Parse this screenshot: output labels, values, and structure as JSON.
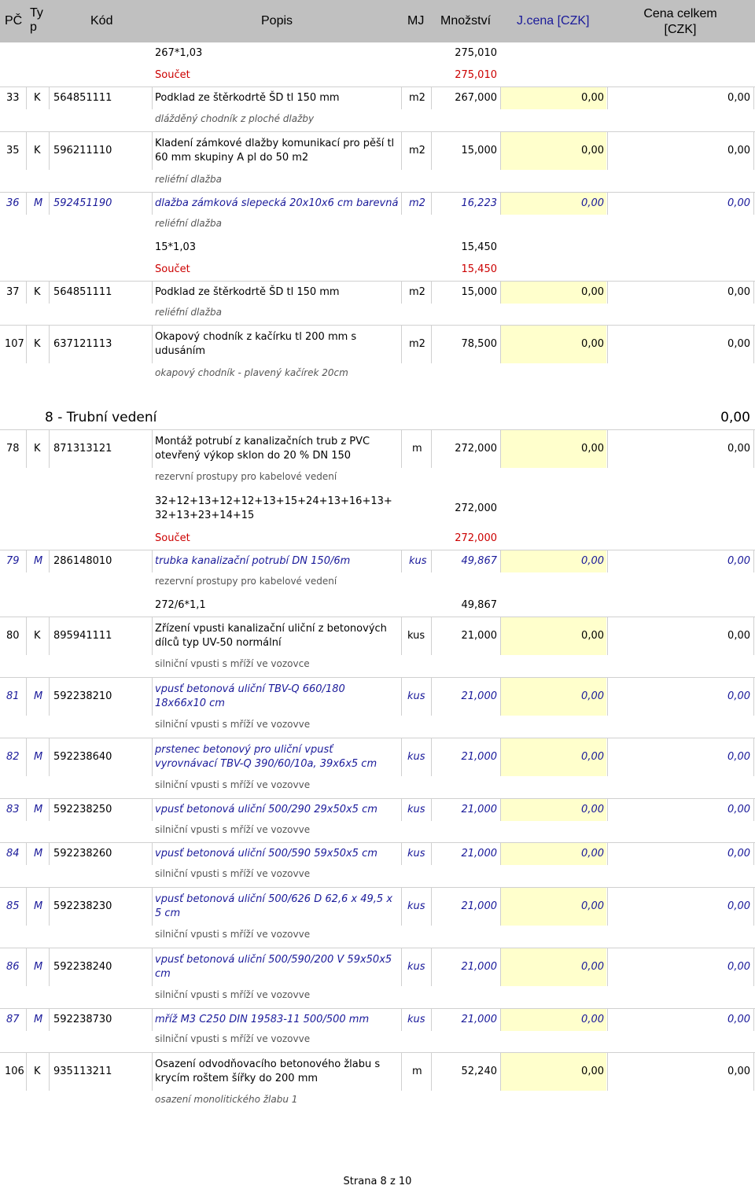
{
  "header": {
    "pc": "PČ",
    "typ": "Ty p",
    "kod": "Kód",
    "popis": "Popis",
    "mj": "MJ",
    "mnozstvi": "Množství",
    "jcena": "J.cena [CZK]",
    "cena_celkem": "Cena celkem [CZK]"
  },
  "calc_top": {
    "formula": "267*1,03",
    "value": "275,010",
    "soucet_label": "Součet",
    "soucet_value": "275,010"
  },
  "items": [
    {
      "pc": "33",
      "typ": "K",
      "kod": "564851111",
      "popis": "Podklad ze štěrkodrtě ŠD tl 150 mm",
      "mj": "m2",
      "mnozstvi": "267,000",
      "jcena": "0,00",
      "celkem": "0,00",
      "note": "dlážděný chodník z ploché dlažby"
    },
    {
      "pc": "35",
      "typ": "K",
      "kod": "596211110",
      "popis": "Kladení zámkové dlažby komunikací pro pěší tl 60 mm skupiny A pl do 50 m2",
      "mj": "m2",
      "mnozstvi": "15,000",
      "jcena": "0,00",
      "celkem": "0,00",
      "note": "reliéfní dlažba"
    },
    {
      "pc": "36",
      "typ": "M",
      "kod": "592451190",
      "popis": "dlažba zámková slepecká 20x10x6 cm barevná",
      "mj": "m2",
      "mnozstvi": "16,223",
      "jcena": "0,00",
      "celkem": "0,00",
      "note": "reliéfní dlažba",
      "calc_formula": "15*1,03",
      "calc_value": "15,450",
      "soucet_label": "Součet",
      "soucet_value": "15,450"
    },
    {
      "pc": "37",
      "typ": "K",
      "kod": "564851111",
      "popis": "Podklad ze štěrkodrtě ŠD tl 150 mm",
      "mj": "m2",
      "mnozstvi": "15,000",
      "jcena": "0,00",
      "celkem": "0,00",
      "note": "reliéfní dlažba"
    },
    {
      "pc": "107",
      "typ": "K",
      "kod": "637121113",
      "popis": "Okapový chodník z kačírku tl 200 mm s udusáním",
      "mj": "m2",
      "mnozstvi": "78,500",
      "jcena": "0,00",
      "celkem": "0,00",
      "note": "okapový chodník - plavený kačírek 20cm"
    }
  ],
  "section": {
    "title": "8 - Trubní vedení",
    "total": "0,00"
  },
  "items2": [
    {
      "pc": "78",
      "typ": "K",
      "kod": "871313121",
      "popis": "Montáž potrubí z kanalizačních trub z PVC otevřený výkop sklon do 20 % DN 150",
      "mj": "m",
      "mnozstvi": "272,000",
      "jcena": "0,00",
      "celkem": "0,00",
      "note": "rezervní prostupy pro kabelové vedení",
      "calc_formula": "32+12+13+12+12+13+15+24+13+16+13+32+13+23+14+15",
      "calc_value": "272,000",
      "soucet_label": "Součet",
      "soucet_value": "272,000"
    },
    {
      "pc": "79",
      "typ": "M",
      "kod": "286148010",
      "popis": "trubka kanalizační potrubí DN 150/6m",
      "mj": "kus",
      "mnozstvi": "49,867",
      "jcena": "0,00",
      "celkem": "0,00",
      "note": "rezervní prostupy pro kabelové vedení",
      "calc_formula": "272/6*1,1",
      "calc_value": "49,867"
    },
    {
      "pc": "80",
      "typ": "K",
      "kod": "895941111",
      "popis": "Zřízení vpusti kanalizační uliční z betonových dílců typ UV-50 normální",
      "mj": "kus",
      "mnozstvi": "21,000",
      "jcena": "0,00",
      "celkem": "0,00",
      "note": "silniční vpusti s mříží ve vozovce"
    },
    {
      "pc": "81",
      "typ": "M",
      "kod": "592238210",
      "popis": "vpusť betonová uliční TBV-Q 660/180 18x66x10 cm",
      "mj": "kus",
      "mnozstvi": "21,000",
      "jcena": "0,00",
      "celkem": "0,00",
      "note": "silniční vpusti s mříží ve vozovve"
    },
    {
      "pc": "82",
      "typ": "M",
      "kod": "592238640",
      "popis": "prstenec betonový pro uliční vpusť vyrovnávací TBV-Q 390/60/10a, 39x6x5 cm",
      "mj": "kus",
      "mnozstvi": "21,000",
      "jcena": "0,00",
      "celkem": "0,00",
      "note": "silniční vpusti s mříží ve vozovve"
    },
    {
      "pc": "83",
      "typ": "M",
      "kod": "592238250",
      "popis": "vpusť betonová uliční 500/290 29x50x5 cm",
      "mj": "kus",
      "mnozstvi": "21,000",
      "jcena": "0,00",
      "celkem": "0,00",
      "note": "silniční vpusti s mříží ve vozovve"
    },
    {
      "pc": "84",
      "typ": "M",
      "kod": "592238260",
      "popis": "vpusť betonová uliční 500/590 59x50x5 cm",
      "mj": "kus",
      "mnozstvi": "21,000",
      "jcena": "0,00",
      "celkem": "0,00",
      "note": "silniční vpusti s mříží ve vozovve"
    },
    {
      "pc": "85",
      "typ": "M",
      "kod": "592238230",
      "popis": "vpusť betonová uliční 500/626 D 62,6 x 49,5 x 5 cm",
      "mj": "kus",
      "mnozstvi": "21,000",
      "jcena": "0,00",
      "celkem": "0,00",
      "note": "silniční vpusti s mříží ve vozovve"
    },
    {
      "pc": "86",
      "typ": "M",
      "kod": "592238240",
      "popis": "vpusť betonová uliční 500/590/200 V 59x50x5 cm",
      "mj": "kus",
      "mnozstvi": "21,000",
      "jcena": "0,00",
      "celkem": "0,00",
      "note": "silniční vpusti s mříží ve vozovve"
    },
    {
      "pc": "87",
      "typ": "M",
      "kod": "592238730",
      "popis": "mříž M3 C250 DIN 19583-11 500/500 mm",
      "mj": "kus",
      "mnozstvi": "21,000",
      "jcena": "0,00",
      "celkem": "0,00",
      "note": "silniční vpusti s mříží ve vozovve"
    },
    {
      "pc": "106",
      "typ": "K",
      "kod": "935113211",
      "popis": "Osazení odvodňovacího betonového žlabu s krycím roštem šířky do 200 mm",
      "mj": "m",
      "mnozstvi": "52,240",
      "jcena": "0,00",
      "celkem": "0,00",
      "note": "osazení monolitického žlabu 1"
    }
  ],
  "footer": "Strana 8 z 10"
}
